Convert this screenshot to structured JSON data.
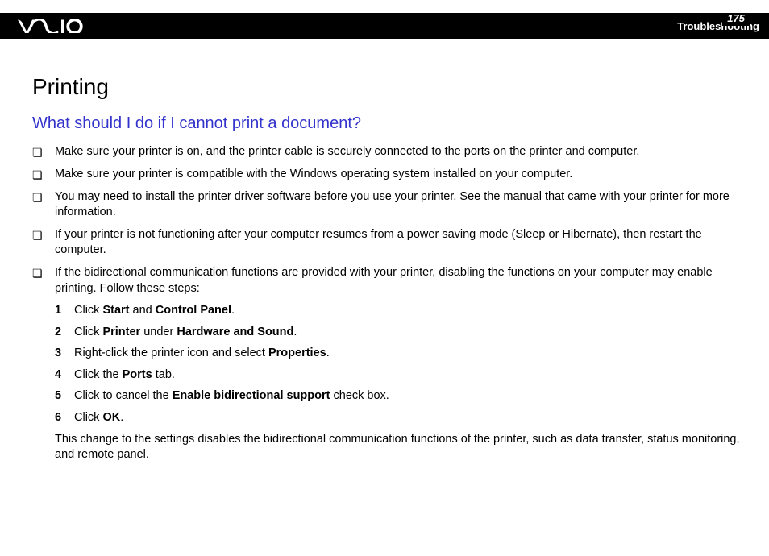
{
  "header": {
    "page_number": "175",
    "section": "Troubleshooting"
  },
  "content": {
    "title": "Printing",
    "subtitle": "What should I do if I cannot print a document?",
    "bullets": [
      "Make sure your printer is on, and the printer cable is securely connected to the ports on the printer and computer.",
      "Make sure your printer is compatible with the Windows operating system installed on your computer.",
      "You may need to install the printer driver software before you use your printer. See the manual that came with your printer for more information.",
      "If your printer is not functioning after your computer resumes from a power saving mode (Sleep or Hibernate), then restart the computer.",
      "If the bidirectional communication functions are provided with your printer, disabling the functions on your computer may enable printing. Follow these steps:"
    ],
    "steps": [
      {
        "num": "1",
        "pre": "Click ",
        "b1": "Start",
        "mid": " and ",
        "b2": "Control Panel",
        "post": "."
      },
      {
        "num": "2",
        "pre": "Click ",
        "b1": "Printer",
        "mid": " under ",
        "b2": "Hardware and Sound",
        "post": "."
      },
      {
        "num": "3",
        "pre": "Right-click the printer icon and select ",
        "b1": "Properties",
        "mid": "",
        "b2": "",
        "post": "."
      },
      {
        "num": "4",
        "pre": "Click the ",
        "b1": "Ports",
        "mid": "",
        "b2": "",
        "post": " tab."
      },
      {
        "num": "5",
        "pre": "Click to cancel the ",
        "b1": "Enable bidirectional support",
        "mid": "",
        "b2": "",
        "post": " check box."
      },
      {
        "num": "6",
        "pre": "Click ",
        "b1": "OK",
        "mid": "",
        "b2": "",
        "post": "."
      }
    ],
    "closing": "This change to the settings disables the bidirectional communication functions of the printer, such as data transfer, status monitoring, and remote panel."
  }
}
